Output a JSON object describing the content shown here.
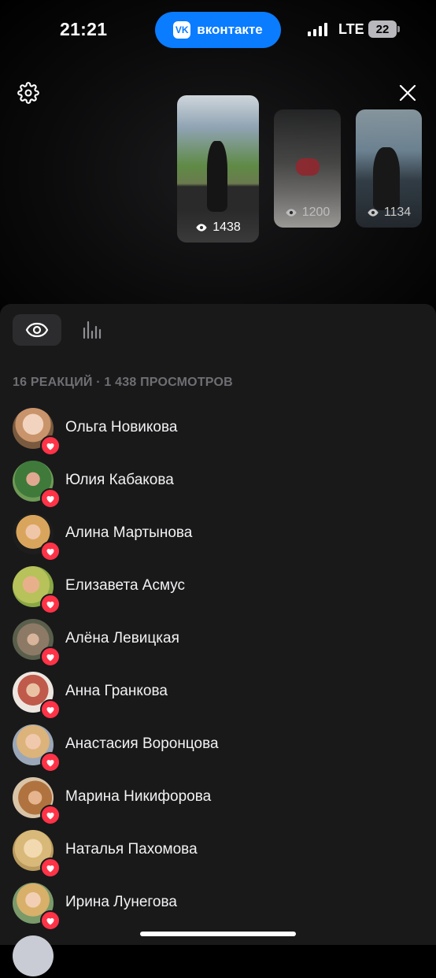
{
  "status_bar": {
    "time": "21:21",
    "app_pill": {
      "logo": "VK",
      "label": "вконтакте"
    },
    "network": "LTE",
    "battery": "22"
  },
  "header": {
    "settings_icon": "gear-icon",
    "close_icon": "close-icon"
  },
  "stories": [
    {
      "views": "1438"
    },
    {
      "views": "1200"
    },
    {
      "views": "1134"
    }
  ],
  "tabs": [
    {
      "icon": "eye-icon",
      "selected": true
    },
    {
      "icon": "bar-chart-icon",
      "selected": false
    }
  ],
  "summary": "16 РЕАКЦИЙ · 1 438 ПРОСМОТРОВ",
  "viewers": [
    {
      "name": "Ольга Новикова",
      "reaction": "heart"
    },
    {
      "name": "Юлия Кабакова",
      "reaction": "heart"
    },
    {
      "name": "Алина Мартынова",
      "reaction": "heart"
    },
    {
      "name": "Елизавета Асмус",
      "reaction": "heart"
    },
    {
      "name": "Алёна Левицкая",
      "reaction": "heart"
    },
    {
      "name": "Анна Гранкова",
      "reaction": "heart"
    },
    {
      "name": "Анастасия Воронцова",
      "reaction": "heart"
    },
    {
      "name": "Марина Никифорова",
      "reaction": "heart"
    },
    {
      "name": "Наталья Пахомова",
      "reaction": "heart"
    },
    {
      "name": "Ирина Лунегова",
      "reaction": "heart"
    }
  ],
  "colors": {
    "accent": "#0a7cff",
    "reaction": "#ff3347",
    "sheet_background": "#19191a"
  }
}
